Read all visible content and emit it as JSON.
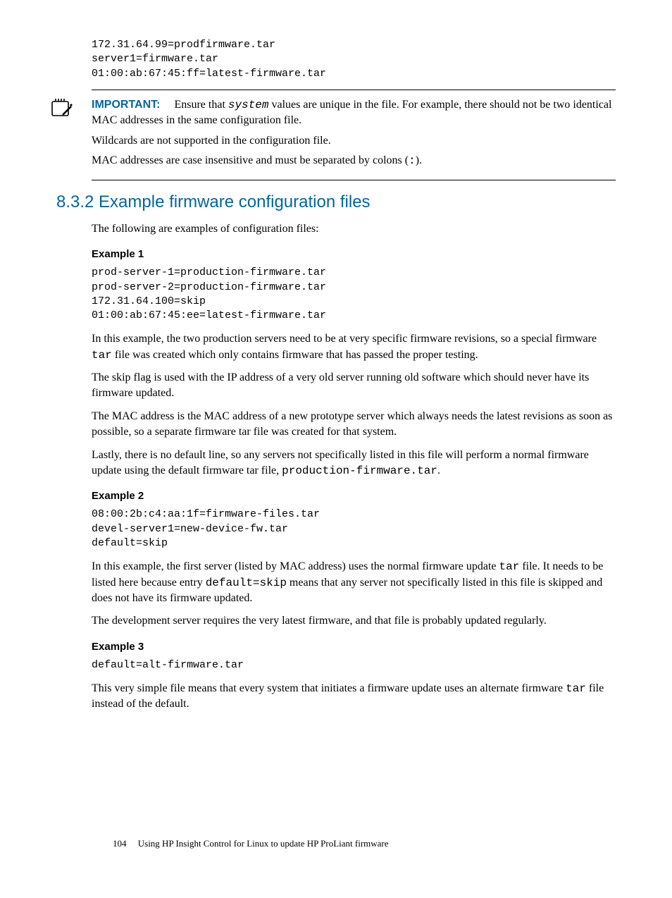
{
  "top_code": "172.31.64.99=prodfirmware.tar\nserver1=firmware.tar\n01:00:ab:67:45:ff=latest-firmware.tar",
  "important": {
    "label": "IMPORTANT:",
    "line1_a": "Ensure that ",
    "line1_code": "system",
    "line1_b": " values are unique in the file. For example, there should not be two identical MAC addresses in the same configuration file.",
    "line2": "Wildcards are not supported in the configuration file.",
    "line3_a": "MAC addresses are case insensitive and must be separated by colons (",
    "line3_code": ":",
    "line3_b": ")."
  },
  "section": {
    "heading": "8.3.2 Example firmware configuration files",
    "intro": "The following are examples of configuration files:"
  },
  "ex1": {
    "heading": "Example 1",
    "code": "prod-server-1=production-firmware.tar\nprod-server-2=production-firmware.tar\n172.31.64.100=skip\n01:00:ab:67:45:ee=latest-firmware.tar",
    "p1_a": "In this example, the two production servers need to be at very specific firmware revisions, so a special firmware ",
    "p1_code": "tar",
    "p1_b": " file was created which only contains firmware that has passed the proper testing.",
    "p2": "The skip flag is used with the IP address of a very old server running old software which should never have its firmware updated.",
    "p3": "The MAC address is the MAC address of a new prototype server which always needs the latest revisions as soon as possible, so a separate firmware tar file was created for that system.",
    "p4_a": "Lastly, there is no default line, so any servers not specifically listed in this file will perform a normal firmware update using the default firmware tar file, ",
    "p4_code": "production-firmware.tar",
    "p4_b": "."
  },
  "ex2": {
    "heading": "Example 2",
    "code": "08:00:2b:c4:aa:1f=firmware-files.tar\ndevel-server1=new-device-fw.tar\ndefault=skip",
    "p1_a": "In this example, the first server (listed by MAC address) uses the normal firmware update ",
    "p1_code1": "tar",
    "p1_b": " file. It needs to be listed here because entry ",
    "p1_code2": "default=skip",
    "p1_c": " means that any server not specifically listed in this file is skipped and does not have its firmware updated.",
    "p2": "The development server requires the very latest firmware, and that file is probably updated regularly."
  },
  "ex3": {
    "heading": "Example 3",
    "code": "default=alt-firmware.tar",
    "p1_a": "This very simple file means that every system that initiates a firmware update uses an alternate firmware ",
    "p1_code": "tar",
    "p1_b": " file instead of the default."
  },
  "footer": {
    "page": "104",
    "title": "Using HP Insight Control for Linux to update HP ProLiant firmware"
  }
}
